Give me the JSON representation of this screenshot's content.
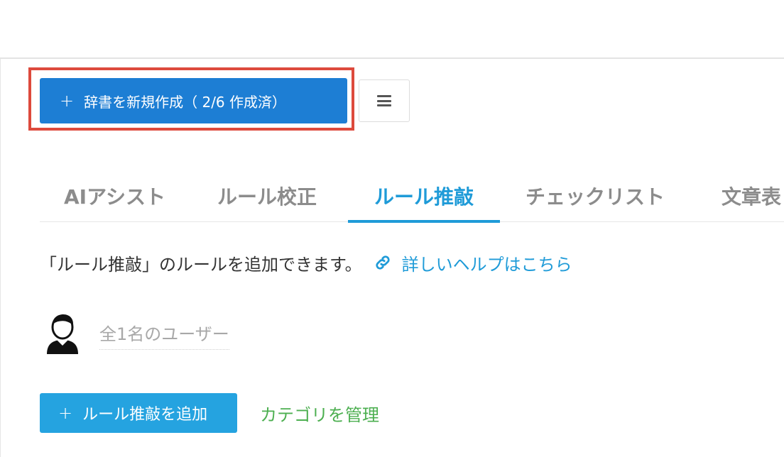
{
  "toolbar": {
    "create_plus": "+",
    "create_label": "辞書を新規作成（ 2/6 作成済）"
  },
  "tabs": [
    {
      "label": "AIアシスト",
      "active": false
    },
    {
      "label": "ルール校正",
      "active": false
    },
    {
      "label": "ルール推敲",
      "active": true
    },
    {
      "label": "チェックリスト",
      "active": false
    },
    {
      "label": "文章表",
      "active": false
    }
  ],
  "description": {
    "text": "「ルール推敲」のルールを追加できます。",
    "help_link": "詳しいヘルプはこちら"
  },
  "users": {
    "label": "全1名のユーザー"
  },
  "actions": {
    "add_plus": "+",
    "add_label": "ルール推敲を追加",
    "manage_categories": "カテゴリを管理"
  },
  "colors": {
    "primary_button": "#1d7ed4",
    "accent_blue": "#1f9bd8",
    "green_link": "#4caf50",
    "highlight_border": "#dd4a3d"
  },
  "icons": {
    "menu": "hamburger-icon",
    "link": "link-icon",
    "user": "user-avatar-icon",
    "plus": "plus-icon"
  }
}
